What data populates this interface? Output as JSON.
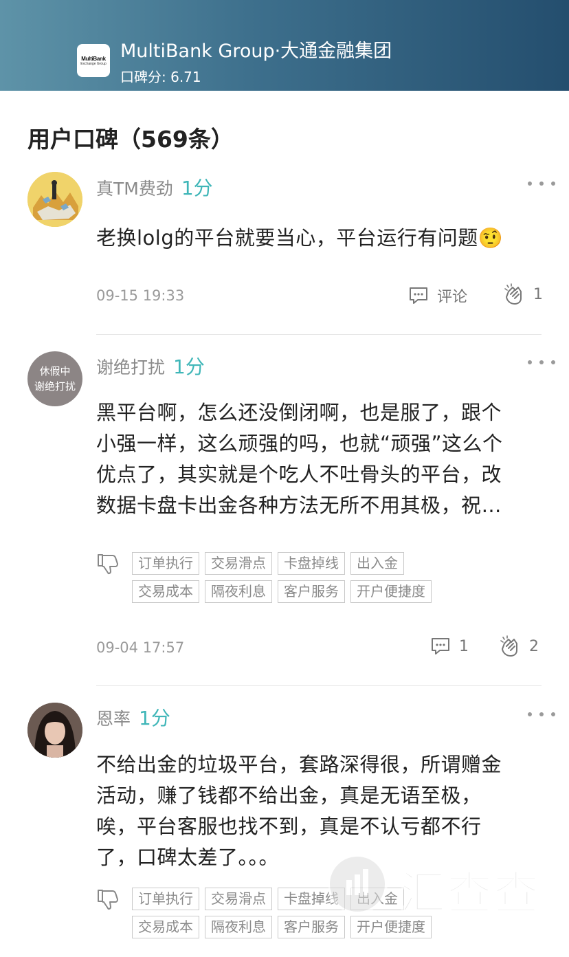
{
  "header": {
    "logo_line1": "MultiBank",
    "logo_line2": "Exchange Group",
    "broker_name": "MultiBank Group·大通金融集团",
    "score_text": "口碑分: 6.71"
  },
  "section_title": "用户口碑（569条）",
  "reviews": [
    {
      "avatar_label": "",
      "username": "真TM费劲",
      "rating": "1分",
      "lines": [
        "老换lolg的平台就要当心，平台运行有问题🤨"
      ],
      "tags": [],
      "date": "09-15 19:33",
      "comment_label": "评论",
      "clap_count": "1"
    },
    {
      "avatar_line1": "休假中",
      "avatar_line2": "谢绝打扰",
      "username": "谢绝打扰",
      "rating": "1分",
      "lines": [
        "黑平台啊，怎么还没倒闭啊，也是服了，跟个",
        "小强一样，这么顽强的吗，也就“顽强”这么个",
        "优点了，其实就是个吃人不吐骨头的平台，改",
        "数据卡盘卡出金各种方法无所不用其极，祝…"
      ],
      "tags": [
        [
          "订单执行",
          "交易滑点",
          "卡盘掉线",
          "出入金"
        ],
        [
          "交易成本",
          "隔夜利息",
          "客户服务",
          "开户便捷度"
        ]
      ],
      "date": "09-04 17:57",
      "comment_label": "1",
      "clap_count": "2"
    },
    {
      "username": "恩率",
      "rating": "1分",
      "lines": [
        "不给出金的垃圾平台，套路深得很，所谓赠金",
        "活动，赚了钱都不给出金，真是无语至极，",
        "唉，平台客服也找不到，真是不认亏都不行",
        "了，口碑太差了。。。"
      ],
      "tags": [
        [
          "订单执行",
          "交易滑点",
          "卡盘掉线",
          "出入金"
        ],
        [
          "交易成本",
          "隔夜利息",
          "客户服务",
          "开户便捷度"
        ]
      ]
    }
  ],
  "watermark_text": "汇查查",
  "colors": {
    "accent": "#3fb6b8",
    "header_start": "#5e93a8",
    "header_end": "#244e6e"
  }
}
